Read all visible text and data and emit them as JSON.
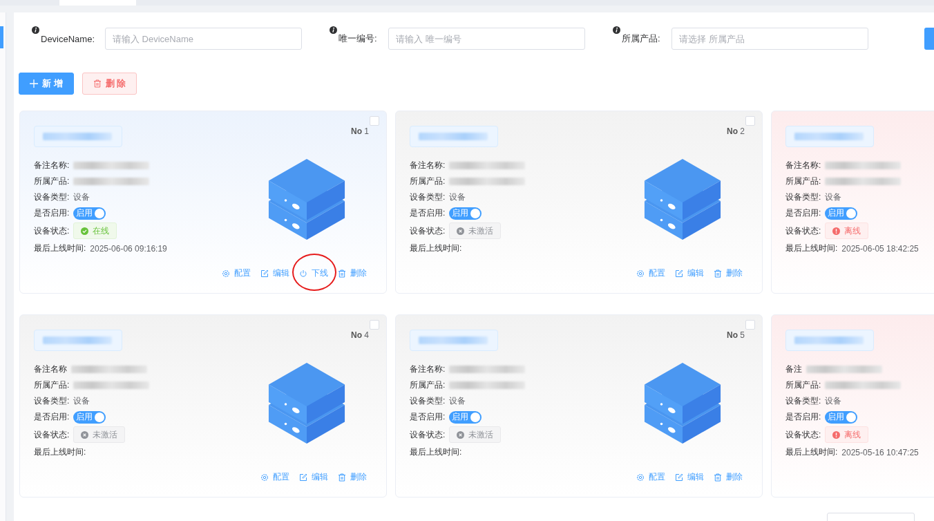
{
  "filters": [
    {
      "label": "DeviceName:",
      "placeholder": "请输入 DeviceName"
    },
    {
      "label": "唯一编号:",
      "placeholder": "请输入 唯一编号"
    },
    {
      "label": "所属产品:",
      "placeholder": "请选择 所属产品"
    }
  ],
  "toolbar": [
    {
      "kind": "add",
      "label": "新 增"
    },
    {
      "kind": "delete",
      "label": "删 除"
    }
  ],
  "cards": [
    {
      "number_label": "No",
      "number": "1",
      "checked": false,
      "fields": [
        {
          "label": "备注名称:",
          "kind": "redacted"
        },
        {
          "label": "所属产品:",
          "kind": "redacted"
        },
        {
          "label": "设备类型:",
          "kind": "text",
          "value": "设备"
        },
        {
          "label": "是否启用:",
          "kind": "switch",
          "on": true,
          "text": "启用"
        },
        {
          "label": "设备状态:",
          "kind": "status",
          "color": "#67c23a",
          "text": "在线"
        },
        {
          "label": "最后上线时间:",
          "kind": "text",
          "value": "2025-06-06 09:16:19"
        }
      ],
      "actions": [
        {
          "kind": "config",
          "label": "配置",
          "circled": false
        },
        {
          "kind": "edit",
          "label": "编辑",
          "circled": false
        },
        {
          "kind": "offline",
          "label": "下线",
          "circled": true
        },
        {
          "kind": "delete",
          "label": "删除",
          "circled": false
        }
      ]
    },
    {
      "number_label": "No",
      "number": "2",
      "checked": false,
      "fields": [
        {
          "label": "备注名称:",
          "kind": "redacted"
        },
        {
          "label": "所属产品:",
          "kind": "redacted"
        },
        {
          "label": "设备类型:",
          "kind": "text",
          "value": "设备"
        },
        {
          "label": "是否启用:",
          "kind": "switch",
          "on": true,
          "text": "启用"
        },
        {
          "label": "设备状态:",
          "kind": "status",
          "color": "#909399",
          "text": "未激活"
        },
        {
          "label": "最后上线时间:",
          "kind": "text"
        }
      ],
      "actions": [
        {
          "kind": "config",
          "label": "配置",
          "circled": false
        },
        {
          "kind": "edit",
          "label": "编辑",
          "circled": false
        },
        {
          "kind": "delete",
          "label": "删除",
          "circled": false
        }
      ]
    },
    {
      "fields": [
        {
          "label": "备注名称:",
          "kind": "redacted"
        },
        {
          "label": "所属产品:",
          "kind": "redacted"
        },
        {
          "label": "设备类型:",
          "kind": "text",
          "value": "设备"
        },
        {
          "label": "是否启用:",
          "kind": "switch",
          "on": true,
          "text": "启用"
        },
        {
          "label": "设备状态:",
          "kind": "status",
          "color": "#f56c6c",
          "text": "离线"
        },
        {
          "label": "最后上线时间:",
          "kind": "text",
          "value": "2025-06-05 18:42:25"
        }
      ]
    },
    {
      "number_label": "No",
      "number": "4",
      "checked": false,
      "fields": [
        {
          "label": "备注名称",
          "kind": "redacted"
        },
        {
          "label": "所属产品:",
          "kind": "redacted"
        },
        {
          "label": "设备类型:",
          "kind": "text",
          "value": "设备"
        },
        {
          "label": "是否启用:",
          "kind": "switch",
          "on": true,
          "text": "启用"
        },
        {
          "label": "设备状态:",
          "kind": "status",
          "color": "#909399",
          "text": "未激活"
        },
        {
          "label": "最后上线时间:",
          "kind": "text"
        }
      ],
      "actions": [
        {
          "kind": "config",
          "label": "配置",
          "circled": false
        },
        {
          "kind": "edit",
          "label": "编辑",
          "circled": false
        },
        {
          "kind": "delete",
          "label": "删除",
          "circled": false
        }
      ]
    },
    {
      "number_label": "No",
      "number": "5",
      "checked": false,
      "fields": [
        {
          "label": "备注名称:",
          "kind": "redacted"
        },
        {
          "label": "所属产品:",
          "kind": "redacted"
        },
        {
          "label": "设备类型:",
          "kind": "text",
          "value": "设备"
        },
        {
          "label": "是否启用:",
          "kind": "switch",
          "on": true,
          "text": "启用"
        },
        {
          "label": "设备状态:",
          "kind": "status",
          "color": "#909399",
          "text": "未激活"
        },
        {
          "label": "最后上线时间:",
          "kind": "text"
        }
      ],
      "actions": [
        {
          "kind": "config",
          "label": "配置",
          "circled": false
        },
        {
          "kind": "edit",
          "label": "编辑",
          "circled": false
        },
        {
          "kind": "delete",
          "label": "删除",
          "circled": false
        }
      ]
    },
    {
      "fields": [
        {
          "label": "备注",
          "kind": "redacted"
        },
        {
          "label": "所属产品:",
          "kind": "redacted"
        },
        {
          "label": "设备类型:",
          "kind": "text",
          "value": "设备"
        },
        {
          "label": "是否启用:",
          "kind": "switch",
          "on": true,
          "text": "启用"
        },
        {
          "label": "设备状态:",
          "kind": "status",
          "color": "#f56c6c",
          "text": "离线"
        },
        {
          "label": "最后上线时间:",
          "kind": "text",
          "value": "2025-05-16 10:47:25"
        }
      ]
    }
  ]
}
